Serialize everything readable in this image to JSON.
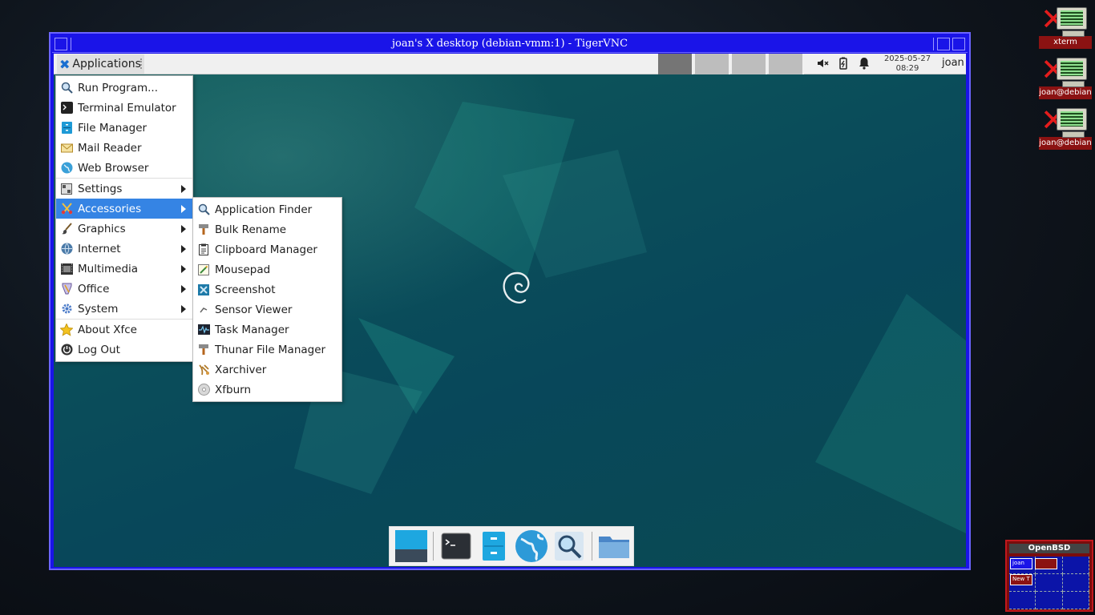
{
  "vnc_window": {
    "title": "joan's X desktop (debian-vmm:1) - TigerVNC"
  },
  "panel": {
    "applications_label": "Applications",
    "clock_date": "2025-05-27",
    "clock_time": "08:29",
    "user": "joan"
  },
  "menu": {
    "items": [
      {
        "label": "Run Program...",
        "icon": "search-icon"
      },
      {
        "label": "Terminal Emulator",
        "icon": "terminal-icon"
      },
      {
        "label": "File Manager",
        "icon": "file-cabinet-icon"
      },
      {
        "label": "Mail Reader",
        "icon": "envelope-icon"
      },
      {
        "label": "Web Browser",
        "icon": "globe-icon"
      },
      {
        "label": "Settings",
        "icon": "settings-icon"
      },
      {
        "label": "Accessories",
        "icon": "accessories-icon"
      },
      {
        "label": "Graphics",
        "icon": "paintbrush-icon"
      },
      {
        "label": "Internet",
        "icon": "globe-icon"
      },
      {
        "label": "Multimedia",
        "icon": "film-icon"
      },
      {
        "label": "Office",
        "icon": "office-icon"
      },
      {
        "label": "System",
        "icon": "gear-icon"
      },
      {
        "label": "About Xfce",
        "icon": "star-icon"
      },
      {
        "label": "Log Out",
        "icon": "power-icon"
      }
    ]
  },
  "accessories": {
    "items": [
      {
        "label": "Application Finder",
        "icon": "search-icon"
      },
      {
        "label": "Bulk Rename",
        "icon": "rename-icon"
      },
      {
        "label": "Clipboard Manager",
        "icon": "clipboard-icon"
      },
      {
        "label": "Mousepad",
        "icon": "text-editor-icon"
      },
      {
        "label": "Screenshot",
        "icon": "screenshot-icon"
      },
      {
        "label": "Sensor Viewer",
        "icon": "sensor-icon"
      },
      {
        "label": "Task Manager",
        "icon": "activity-icon"
      },
      {
        "label": "Thunar File Manager",
        "icon": "file-manager-icon"
      },
      {
        "label": "Xarchiver",
        "icon": "archive-icon"
      },
      {
        "label": "Xfburn",
        "icon": "disc-icon"
      }
    ]
  },
  "desktop_icons": [
    {
      "label": "xterm"
    },
    {
      "label": "joan@debian"
    },
    {
      "label": "joan@debian"
    }
  ],
  "pager": {
    "title": "OpenBSD",
    "windows": [
      "joan",
      "New T"
    ]
  },
  "colors": {
    "vnc_frame": "#1a14e8",
    "menu_highlight": "#3584e4",
    "desktop_label_bg": "#8b1212"
  }
}
